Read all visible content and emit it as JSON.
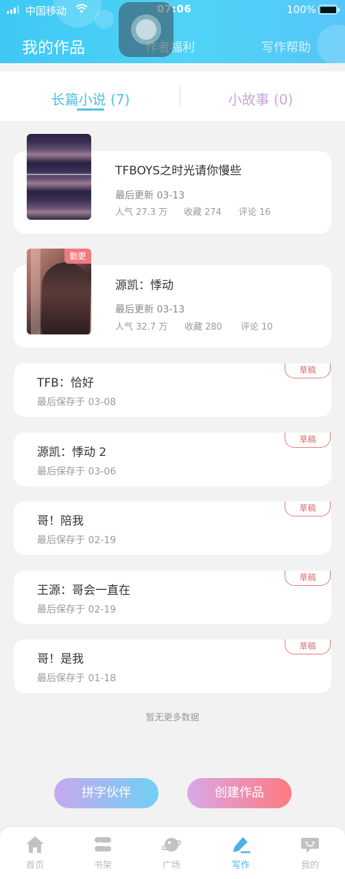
{
  "status_bar": {
    "carrier": "中国移动",
    "time": "07:06",
    "battery": "100%"
  },
  "header": {
    "tabs": [
      {
        "label": "我的作品",
        "active": true
      },
      {
        "label": "作者福利",
        "active": false
      },
      {
        "label": "写作帮助",
        "active": false
      }
    ]
  },
  "content_tabs": [
    {
      "label": "长篇小说 (7)",
      "active": true
    },
    {
      "label": "小故事 (0)",
      "active": false
    }
  ],
  "novels": [
    {
      "title": "TFBOYS之时光请你慢些",
      "updated": "最后更新 03-13",
      "popularity": "人气 27.3 万",
      "favorites": "收藏 274",
      "comments": "评论 16",
      "badge": ""
    },
    {
      "title": "源凯：悸动",
      "updated": "最后更新 03-13",
      "popularity": "人气 32.7 万",
      "favorites": "收藏 280",
      "comments": "评论 10",
      "badge": "勤更"
    }
  ],
  "drafts": [
    {
      "title": "TFB：恰好",
      "saved": "最后保存于 03-08",
      "tag": "草稿"
    },
    {
      "title": "源凯：悸动 2",
      "saved": "最后保存于 03-06",
      "tag": "草稿"
    },
    {
      "title": "哥！陪我",
      "saved": "最后保存于 02-19",
      "tag": "草稿"
    },
    {
      "title": "王源：哥会一直在",
      "saved": "最后保存于 02-19",
      "tag": "草稿"
    },
    {
      "title": "哥！是我",
      "saved": "最后保存于 01-18",
      "tag": "草稿"
    }
  ],
  "no_more_text": "暂无更多数据",
  "actions": {
    "partner": "拼字伙伴",
    "create": "创建作品"
  },
  "bottom_nav": [
    {
      "label": "首页",
      "icon": "home-icon",
      "active": false
    },
    {
      "label": "书架",
      "icon": "bookshelf-icon",
      "active": false
    },
    {
      "label": "广场",
      "icon": "planet-icon",
      "active": false
    },
    {
      "label": "写作",
      "icon": "pen-icon",
      "active": true
    },
    {
      "label": "我的",
      "icon": "chat-face-icon",
      "active": false
    }
  ],
  "colors": {
    "header_gradient_start": "#3fc8f5",
    "accent_blue": "#4ac0e6",
    "draft_red": "#e06a6a",
    "nav_active": "#4ab0e8"
  }
}
